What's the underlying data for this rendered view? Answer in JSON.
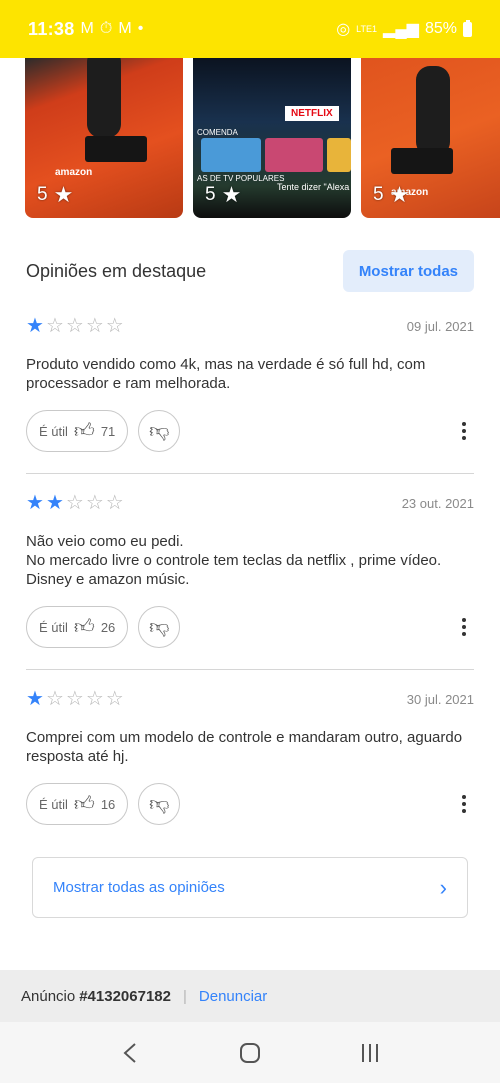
{
  "status_bar": {
    "time": "11:38",
    "battery": "85%",
    "network": "LTE1",
    "icons": [
      "gmail-icon",
      "timer-icon",
      "gmail-icon",
      "dot-icon",
      "hotspot-icon",
      "volte-icon",
      "5g-icon",
      "signal-icon",
      "battery-icon"
    ]
  },
  "photos": [
    {
      "rating": "5",
      "brand": "amazon"
    },
    {
      "rating": "5",
      "badge": "NETFLIX",
      "row_label": "COMENDA",
      "row_label_2": "AS DE TV POPULARES",
      "search_hint": "Tente dizer \"Alexa"
    },
    {
      "rating": "5",
      "brand": "amazon"
    }
  ],
  "reviews_section": {
    "title": "Opiniões em destaque",
    "show_all_label": "Mostrar todas"
  },
  "reviews": [
    {
      "rating": 1,
      "date": "09 jul. 2021",
      "text": "Produto vendido como 4k, mas na verdade é só full hd, com processador e ram melhorada.",
      "useful_label": "É útil",
      "useful_count": "71"
    },
    {
      "rating": 2,
      "date": "23 out. 2021",
      "text": "Não veio como eu pedi.\nNo mercado livre o controle tem teclas da netflix , prime vídeo. Disney e amazon músic.",
      "useful_label": "É útil",
      "useful_count": "26"
    },
    {
      "rating": 1,
      "date": "30 jul. 2021",
      "text": "Comprei com um modelo de controle e mandaram outro, aguardo resposta até hj.",
      "useful_label": "É útil",
      "useful_count": "16"
    }
  ],
  "all_opinions_label": "Mostrar todas as opiniões",
  "footer": {
    "ad_label": "Anúncio",
    "ad_number": "#4132067182",
    "report_label": "Denunciar"
  },
  "colors": {
    "status_bar": "#fde400",
    "accent": "#3483fa",
    "accent_bg": "#e3edfb"
  }
}
